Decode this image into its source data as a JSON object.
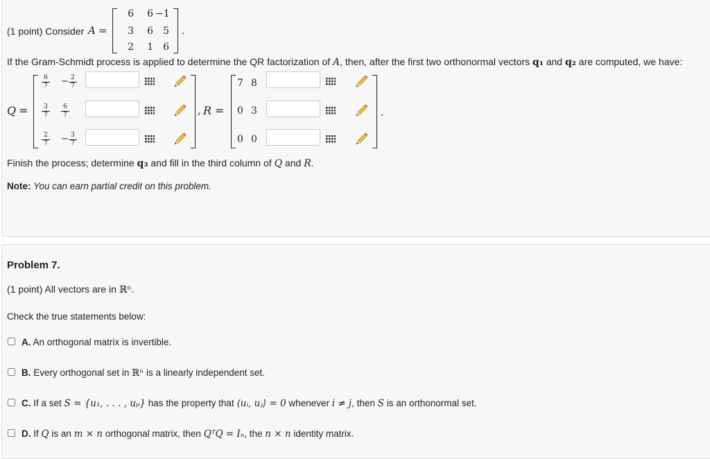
{
  "problem6": {
    "points": "(1 point) Consider",
    "A_label": "A",
    "A_matrix": [
      [
        "6",
        "6",
        "−1"
      ],
      [
        "3",
        "6",
        "5"
      ],
      [
        "2",
        "1",
        "6"
      ]
    ],
    "intro_pre": "If the Gram-Schmidt process is applied to determine the QR factorization of",
    "intro_mid": ", then, after the first two orthonormal vectors",
    "intro_and": "and",
    "intro_post": "are computed, we have:",
    "q1": "q₁",
    "q2": "q₂",
    "Q_label": "Q",
    "R_label": "R",
    "Q_fracs": [
      {
        "sign": "",
        "num": "6",
        "den": "7"
      },
      {
        "sign": "−",
        "num": "2",
        "den": "7"
      },
      {
        "sign": "",
        "num": "3",
        "den": "7"
      },
      {
        "sign": "",
        "num": "6",
        "den": "7"
      },
      {
        "sign": "",
        "num": "2",
        "den": "7"
      },
      {
        "sign": "−",
        "num": "3",
        "den": "7"
      }
    ],
    "R_values": [
      [
        "7",
        "8"
      ],
      [
        "0",
        "3"
      ],
      [
        "0",
        "0"
      ]
    ],
    "finish_pre": "Finish the process; determine",
    "q3": "q₃",
    "finish_mid": "and fill in the third column of",
    "finish_and": "and",
    "note_label": "Note:",
    "note_text": "You can earn partial credit on this problem."
  },
  "problem7": {
    "title": "Problem 7.",
    "points": "(1 point) All vectors are in",
    "Rn": "ℝⁿ",
    "check_text": "Check the true statements below:",
    "options": [
      {
        "letter": "A.",
        "text": "An orthogonal matrix is invertible."
      },
      {
        "letter": "B.",
        "text_pre": "Every orthogonal set in",
        "text_post": "is a linearly independent set."
      },
      {
        "letter": "C.",
        "text_pre": "If a set",
        "S_def": "S = {u₁, . . . , uₚ}",
        "text_mid": "has the property that",
        "inner": "⟨uᵢ, uⱼ⟩ = 0",
        "text_mid2": "whenever",
        "cond": "i ≠ j",
        "text_mid3": ", then",
        "S": "S",
        "text_post": "is an orthonormal set."
      },
      {
        "letter": "D.",
        "text_pre": "If",
        "Q": "Q",
        "text_mid": "is an",
        "dim": "m × n",
        "text_mid2": "orthogonal matrix, then",
        "eq": "QᵀQ = Iₙ",
        "text_mid3": ", the",
        "dim2": "n × n",
        "text_post": "identity matrix."
      }
    ]
  },
  "icons": {
    "grid": "matrix-grid-icon",
    "pencil": "pencil-icon"
  }
}
